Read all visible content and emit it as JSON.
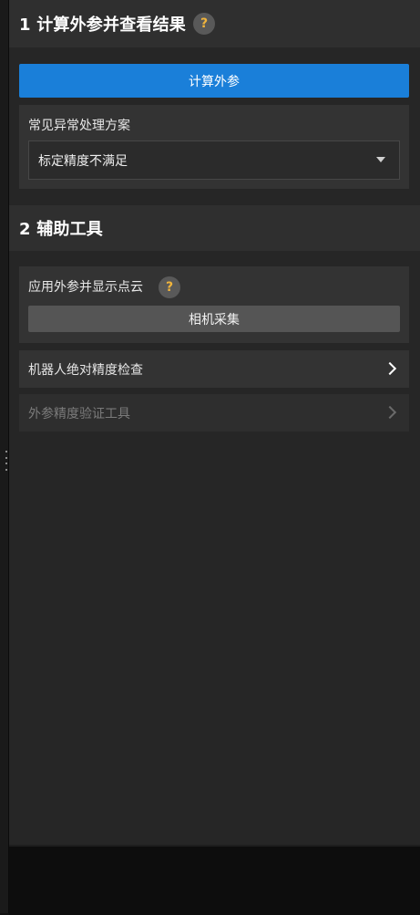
{
  "section1": {
    "title": "1 计算外参并查看结果",
    "help_icon": "?",
    "compute_button": "计算外参",
    "troubleshoot": {
      "label": "常见异常处理方案",
      "selected": "标定精度不满足"
    }
  },
  "section2": {
    "title": "2 辅助工具",
    "pointcloud": {
      "label": "应用外参并显示点云",
      "help_icon": "?",
      "capture_button": "相机采集"
    },
    "robot_accuracy": "机器人绝对精度检查",
    "verify_tool": "外参精度验证工具"
  },
  "colors": {
    "accent": "#1a7fd9",
    "help_icon_glyph": "#f0b43c",
    "panel_bg": "#262626",
    "card_bg": "#333333"
  }
}
